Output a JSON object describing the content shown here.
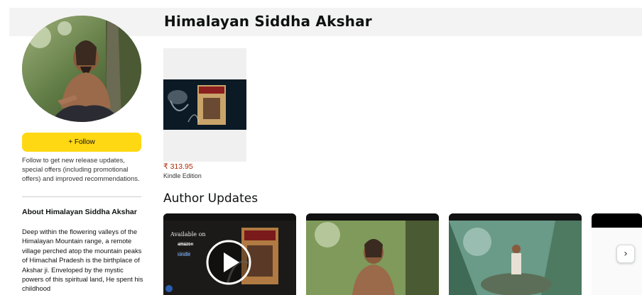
{
  "author": {
    "name": "Himalayan Siddha Akshar"
  },
  "sidebar": {
    "follow_label": "+ Follow",
    "follow_description": "Follow to get new release updates, special offers (including promotional offers) and improved recommendations.",
    "about_title": "About Himalayan Siddha Akshar",
    "about_text": "Deep within the flowering valleys of the Himalayan Mountain range, a remote village perched atop the mountain peaks of Himachal Pradesh is the birthplace of Akshar ji. Enveloped by the mystic powers of this spiritual land, He spent his childhood"
  },
  "book": {
    "price": "₹ 313.95",
    "format": "Kindle Edition"
  },
  "updates": {
    "title": "Author Updates",
    "video_badge_line1": "Available on",
    "video_badge_amazon": "amazon",
    "video_badge_kindle": "kindle"
  },
  "colors": {
    "follow_button": "#ffd814",
    "price": "#b12704",
    "header_band": "#f3f3f3"
  },
  "icons": {
    "play": "play-icon",
    "next": "chevron-right-icon"
  }
}
